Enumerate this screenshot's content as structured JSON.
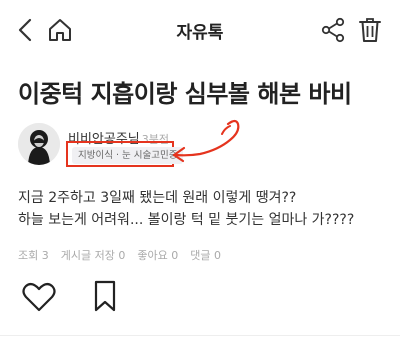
{
  "header": {
    "title": "자유톡",
    "back_icon": "chevron-left-icon",
    "home_icon": "home-icon",
    "share_icon": "share-icon",
    "trash_icon": "trash-icon"
  },
  "post": {
    "title": "이중턱 지흡이랑 심부볼 해본 바비",
    "author": {
      "name": "비비안공주님",
      "count": "3분전",
      "badge": "지방이식 · 눈 시술고민중"
    },
    "body_lines": [
      "지금 2주하고 3일째 됐는데 원래 이렇게 땡겨??",
      "하늘 보는게 어려워... 볼이랑 턱 밑 붓기는 얼마나 가????"
    ],
    "stats": [
      "조회 3",
      "게시글 저장 0",
      "좋아요 0",
      "댓글 0"
    ]
  },
  "colors": {
    "annotation": "#e5341e",
    "text": "#222222",
    "muted": "#aaaaaa",
    "badge_bg": "#f0f0f3"
  }
}
